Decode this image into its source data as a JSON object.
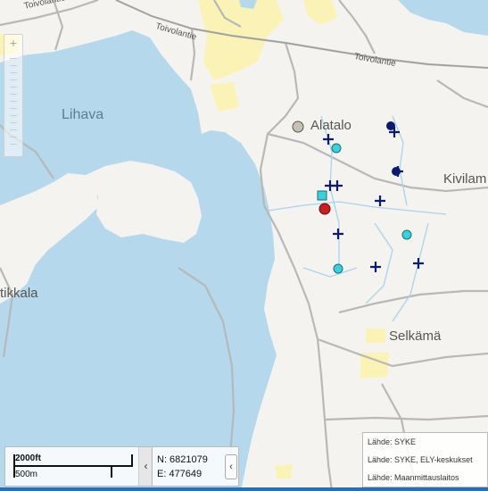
{
  "map": {
    "colors": {
      "water": "#b5d8ec",
      "land": "#f5f3ef",
      "field": "#fbf3b6",
      "road": "#b8b8b8",
      "stream": "#a8d3ea"
    },
    "places": {
      "lihava": "Lihava",
      "alatalo": "Alatalo",
      "kivilam": "Kivilam",
      "tikkala": "tikkala",
      "selkama": "Selkämä"
    },
    "roads": {
      "toivolantie_1": "Toivolantie",
      "toivolantie_2": "Toivolantie",
      "toivolantie_3": "Toivolantie"
    },
    "markers": {
      "cross_color": "#0b1b70",
      "cyan_color": "#37d3dc",
      "red_color": "#cc1e1e",
      "grey_color": "#c8c0b4"
    }
  },
  "zoom": {
    "plus_label": "+"
  },
  "scale": {
    "ft_label": "2000ft",
    "m_label": "500m",
    "toggle_icon": "‹"
  },
  "coords": {
    "north": "N: 6821079",
    "east": "E: 477649",
    "toggle_icon": "‹"
  },
  "attribution": {
    "line1": "Lähde: SYKE",
    "line2": "Lähde: SYKE, ELY-keskukset",
    "line3": "Lähde: Maanmittauslaitos"
  }
}
